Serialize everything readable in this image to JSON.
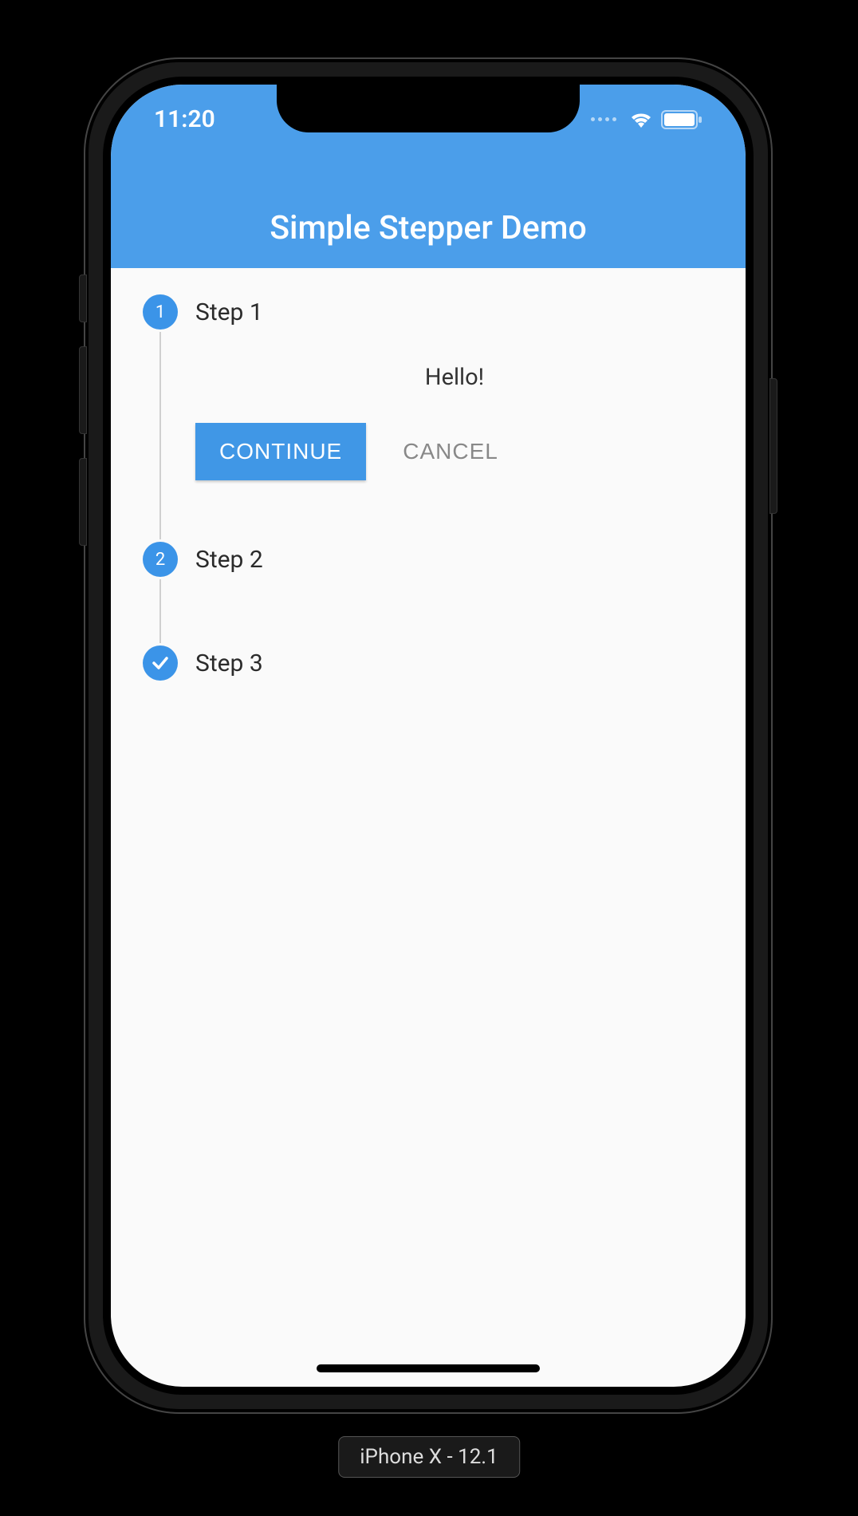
{
  "status": {
    "time": "11:20",
    "signal_icon": "signal-dots",
    "wifi_icon": "wifi-icon",
    "battery_icon": "battery-icon"
  },
  "app": {
    "title": "Simple Stepper Demo"
  },
  "stepper": {
    "steps": [
      {
        "index": "1",
        "label": "Step 1",
        "state": "active"
      },
      {
        "index": "2",
        "label": "Step 2",
        "state": "upcoming"
      },
      {
        "index": "",
        "label": "Step 3",
        "state": "complete",
        "icon": "check"
      }
    ],
    "active_content": "Hello!",
    "continue_label": "CONTINUE",
    "cancel_label": "CANCEL"
  },
  "device_label": "iPhone X - 12.1",
  "colors": {
    "primary": "#4b9eea",
    "button": "#4097e6",
    "step_circle": "#3b94e8"
  }
}
